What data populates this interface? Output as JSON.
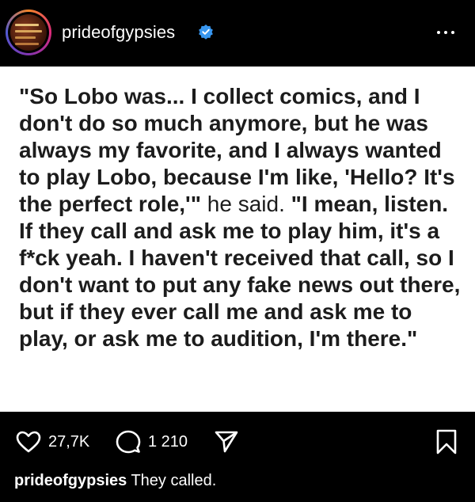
{
  "post": {
    "username": "prideofgypsies",
    "verified": true,
    "quote_bold_1": "\"So Lobo was... I collect comics, and I don't do so much anymore, but he was always my favorite, and I always wanted to play Lobo, because I'm like, 'Hello? It's the perfect role,'\"",
    "quote_plain": " he said. ",
    "quote_bold_2": "\"I mean, listen. If they call and ask me to play him, it's a f*ck yeah. I haven't received that call, so I don't want to put any fake news out there, but if they ever call me and ask me to play, or ask me to audition, I'm there.\""
  },
  "actions": {
    "likes": "27,7K",
    "comments": "1 210"
  },
  "caption": {
    "username": "prideofgypsies",
    "text": "They called."
  },
  "icons": {
    "verified": "verified-badge-icon",
    "more": "more-dots-icon",
    "like": "heart-icon",
    "comment": "comment-bubble-icon",
    "share": "send-icon",
    "save": "bookmark-icon"
  },
  "colors": {
    "background": "#000000",
    "post_background": "#ffffff",
    "verified_blue": "#3897f0",
    "text_dark": "#1c1c1c"
  }
}
